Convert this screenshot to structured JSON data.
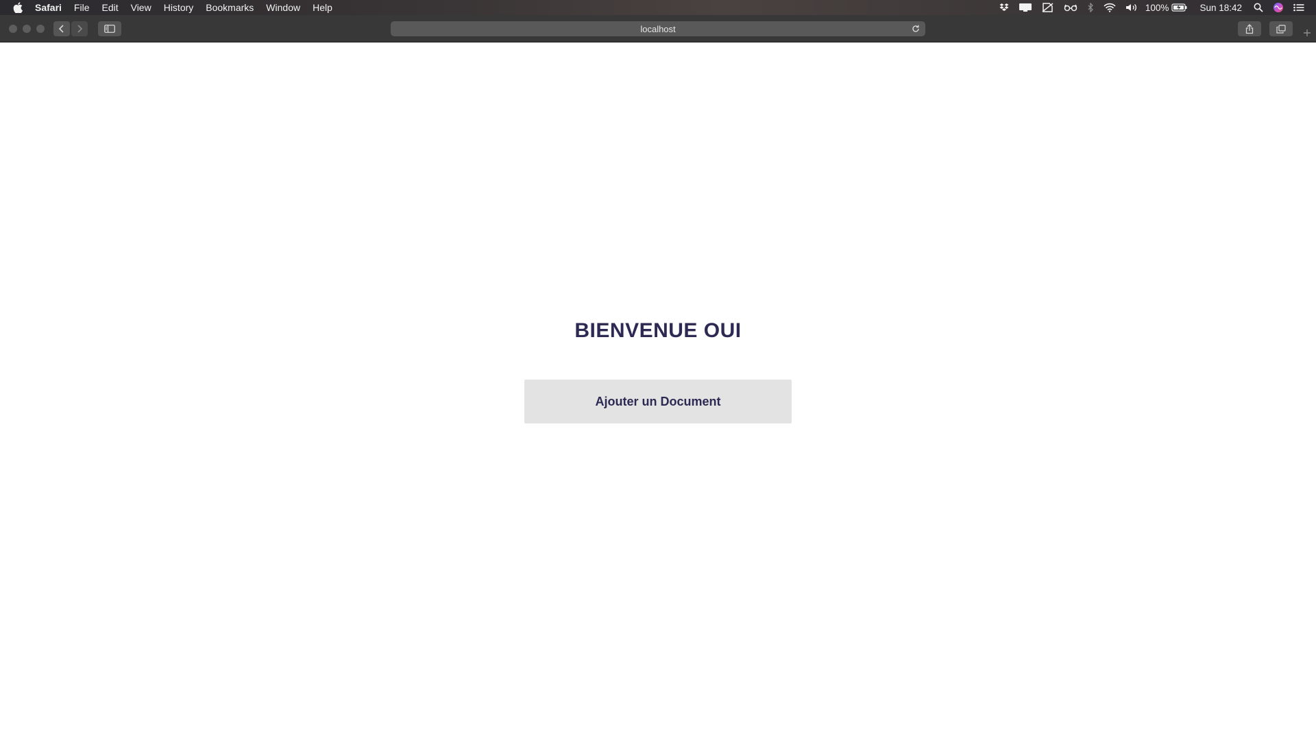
{
  "menubar": {
    "app_name": "Safari",
    "items": [
      "File",
      "Edit",
      "View",
      "History",
      "Bookmarks",
      "Window",
      "Help"
    ],
    "battery": "100%",
    "clock": "Sun 18:42",
    "icons": [
      "apple-icon",
      "dropbox-icon",
      "display-icon",
      "document-icon",
      "glasses-icon",
      "bluetooth-icon",
      "wifi-icon",
      "volume-icon",
      "battery-icon",
      "spotlight-icon",
      "siri-icon",
      "notification-center-icon"
    ]
  },
  "browser": {
    "address": "localhost"
  },
  "page": {
    "title": "BIENVENUE OUI",
    "button_label": "Ajouter un Document"
  },
  "colors": {
    "heading": "#2c2952",
    "button_bg": "#e3e3e3"
  }
}
